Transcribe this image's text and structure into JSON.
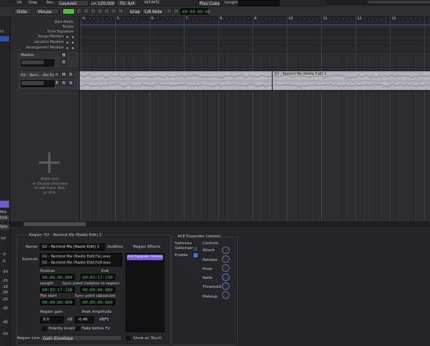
{
  "toolbar": {
    "vs_label": "VS",
    "stop_label": "Stop",
    "rec_label": "Rec:",
    "rec_mode": "Layered",
    "tempo": "♩= 120.000",
    "meter": "TS: 4/4",
    "sync": "INT/MTC",
    "play_cues": "Play Cues",
    "length_label": "Length",
    "slide": "Slide",
    "mouse": "Mouse",
    "snap": "Snap",
    "snap_value": "1/8 Note",
    "clock": "00:00:00:00",
    "edit_mode_label": "□"
  },
  "rulers": [
    "Bars:Beats",
    "Tempo",
    "Time Signature",
    "Range Markers",
    "Location Markers",
    "Arrangement Markers"
  ],
  "bar_numbers": [
    "4",
    "5",
    "6",
    "7",
    "8",
    "9",
    "10",
    "11",
    "12",
    "13"
  ],
  "tracks": {
    "master_name": "Master",
    "audio_name": "02 - Rem... dio Edit)",
    "region_label": "02 - Remind Me (Radio Edit).1",
    "btn_m": "M",
    "btn_s": "S",
    "btn_r": "R",
    "btn_p": "P",
    "btn_a": "A",
    "btn_g": "G",
    "btn_x": "×"
  },
  "empty_hint": [
    "Right-click",
    "or Double-click here",
    "to add Track, Bus,",
    "or VCA."
  ],
  "left_strip": [
    "r2",
    "Mid",
    "Disk",
    "Solo",
    "-inf"
  ],
  "left_scale": [
    "-3",
    "-5",
    "-10",
    "-15",
    "-18",
    "-20",
    "-25",
    "-30",
    "-40",
    "-50"
  ],
  "region_panel": {
    "title": "Region '02 - Remind Me (Radio Edit).1'",
    "name_label": "Name:",
    "name_value": "02 - Remind Me (Radio Edit).1",
    "audition": "Audition",
    "sources_label": "Sources:",
    "source1": "02 - Remind Me (Radio Edit)%L.wav",
    "source2": "02 - Remind Me (Radio Edit)%R.wav",
    "position_label": "Position",
    "end_label": "End",
    "position_value": "00:00:00:000",
    "end_value": "00:03:17:230",
    "length_label": "Length",
    "sync_rel_label": "Sync point (relative to region)",
    "length_value": "00:03:17:230",
    "sync_rel_value": "00:00:00:000",
    "file_start_label": "File start",
    "sync_abs_label": "Sync point (absolute)",
    "file_start_value": "00:00:00:000",
    "sync_abs_value": "00:00:00:000",
    "gain_label": "Region gain",
    "peak_label": "Peak Amplitude",
    "gain_value": "0.0",
    "gain_unit": "dB",
    "peak_value": "-0.46",
    "peak_unit": "dBFS",
    "polarity": "Polarity Invert",
    "fade": "Fade before Fx",
    "effects_label": "Region Effects",
    "effect_item": "ACE Expander (stereo)",
    "show_touch": "Show on Touch",
    "region_line_label": "Region Line:",
    "region_line_value": "Gain Envelope"
  },
  "plugin": {
    "title": "ACE Expander (stereo)",
    "switches": "Switches",
    "sidechain": "Sidechain",
    "enable": "Enable",
    "controls": "Controls",
    "attack": "Attack",
    "release": "Release",
    "knee": "Knee",
    "ratio": "Ratio",
    "threshold": "Threshold",
    "makeup": "Makeup"
  },
  "colors": {
    "accent_green": "#4fbf3a",
    "waveform": "#b6b9c4",
    "waveform_line": "#c0303a",
    "region_bg": "#a9adb8"
  }
}
